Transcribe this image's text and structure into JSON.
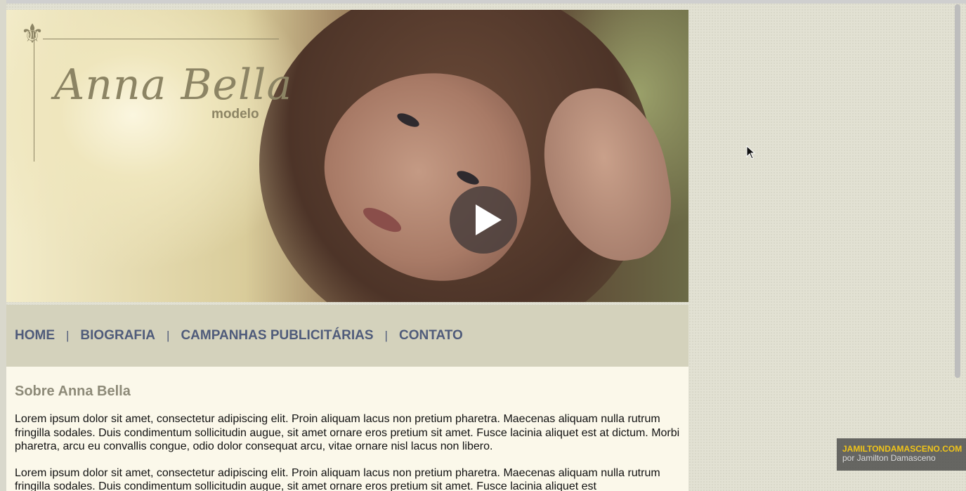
{
  "logo": {
    "name": "Anna Bella",
    "subtitle": "modelo",
    "emblem": "fleur-de-lis"
  },
  "video": {
    "play_icon": "play-icon"
  },
  "nav": {
    "items": [
      "HOME",
      "BIOGRAFIA",
      "CAMPANHAS PUBLICITÁRIAS",
      "CONTATO"
    ],
    "separator": "|"
  },
  "content": {
    "heading": "Sobre Anna Bella",
    "paragraphs": [
      "Lorem ipsum dolor sit amet, consectetur adipiscing elit. Proin aliquam lacus non pretium pharetra. Maecenas aliquam nulla rutrum fringilla sodales. Duis condimentum sollicitudin augue, sit amet ornare eros pretium sit amet. Fusce lacinia aliquet est at dictum. Morbi pharetra, arcu eu convallis congue, odio dolor consequat arcu, vitae ornare nisl lacus non libero.",
      "Lorem ipsum dolor sit amet, consectetur adipiscing elit. Proin aliquam lacus non pretium pharetra. Maecenas aliquam nulla rutrum fringilla sodales. Duis condimentum sollicitudin augue, sit amet ornare eros pretium sit amet. Fusce lacinia aliquet est"
    ]
  },
  "watermark": {
    "site": "JAMILTONDAMASCENO.COM",
    "author": "por Jamilton Damasceno"
  },
  "colors": {
    "nav_text": "#4f5b7a",
    "logo": "#8c8464",
    "nav_bg": "#d4d2bc",
    "content_bg": "#fbf8ea",
    "watermark_site": "#f0c419"
  }
}
